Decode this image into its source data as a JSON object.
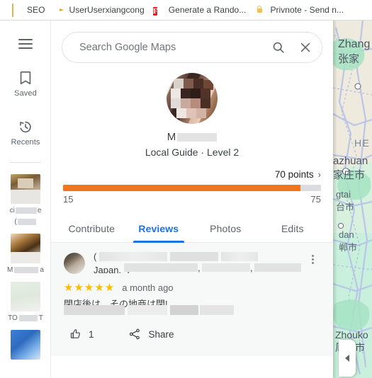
{
  "browser": {
    "bookmarks": [
      {
        "label": "SEO",
        "icon": "folder-icon"
      },
      {
        "label": "UserUserxiangcong",
        "icon": "eagle-favicon"
      },
      {
        "label": "Generate a Rando...",
        "icon": "red-f-favicon"
      },
      {
        "label": "Privnote - Send n...",
        "icon": "red-padlock-favicon"
      }
    ]
  },
  "rail": {
    "menu_icon": "hamburger-icon",
    "items": [
      {
        "label": "Saved",
        "icon": "bookmark-icon"
      },
      {
        "label": "Recents",
        "icon": "history-clock-icon"
      }
    ],
    "thumbnails": [
      {
        "caption_prefix": "ci",
        "caption_mid": "",
        "caption_suffix": "e",
        "caption_line2_prefix": "(",
        "caption_line2_suffix": ""
      },
      {
        "caption_prefix": "M",
        "caption_mid": "",
        "caption_suffix": "a",
        "caption_line2_prefix": "",
        "caption_line2_suffix": ""
      },
      {
        "caption_prefix": "TO",
        "caption_mid": "",
        "caption_suffix": "T",
        "caption_line2_prefix": "",
        "caption_line2_suffix": ""
      },
      {
        "caption_prefix": "",
        "caption_mid": "",
        "caption_suffix": "",
        "caption_line2_prefix": "",
        "caption_line2_suffix": ""
      }
    ]
  },
  "search": {
    "placeholder": "Search Google Maps",
    "value": "",
    "search_icon": "magnifier-icon",
    "clear_icon": "close-x-icon"
  },
  "profile": {
    "avatar_icon": "user-avatar-pixelated",
    "name_visible": "M",
    "subtitle": "Local Guide · Level 2"
  },
  "points": {
    "label": "70 points",
    "chevron": "›",
    "min": "15",
    "max": "75",
    "fill_percent": 92,
    "fill_color": "#ef7622",
    "track_color": "#dadce0"
  },
  "tabs": [
    {
      "label": "Contribute",
      "active": false
    },
    {
      "label": "Reviews",
      "active": true
    },
    {
      "label": "Photos",
      "active": false
    },
    {
      "label": "Edits",
      "active": false
    }
  ],
  "tab_accent_color": "#1a73e8",
  "review": {
    "avatar_icon": "place-thumbnail",
    "title_visible": "(",
    "address_visible": "Japan, 〒",
    "address_comma_1": ",",
    "address_comma_2": ",",
    "stars": "★★★★★",
    "star_count": 5,
    "star_color": "#fbbc04",
    "time": "a month ago",
    "body_visible": "閉店後は、その地商は閉!",
    "more_icon": "overflow-menu-icon",
    "actions": {
      "like_icon": "thumbs-up-icon",
      "like_count": "1",
      "share_icon": "share-icon",
      "share_label": "Share"
    }
  },
  "map": {
    "collapse_icon": "collapse-panel-arrow",
    "labels": [
      {
        "latin": "Zhang",
        "cjk": "张家"
      },
      {
        "latin": "HE",
        "cjk": ""
      },
      {
        "latin": "azhuan",
        "cjk": "家庄市"
      },
      {
        "latin": "gtai",
        "cjk": "台市"
      },
      {
        "latin": "dan",
        "cjk": "郸市"
      },
      {
        "latin": "Zhouko",
        "cjk": "周口市"
      }
    ]
  }
}
